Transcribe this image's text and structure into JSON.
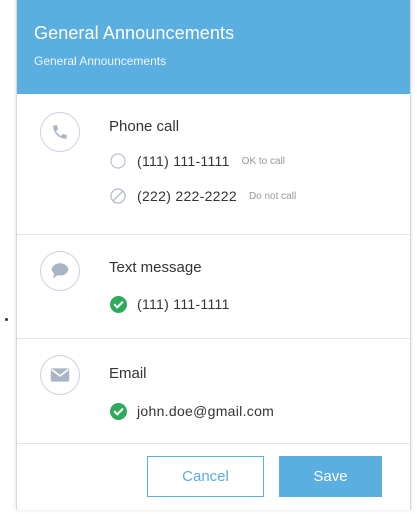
{
  "header": {
    "title": "General Announcements",
    "subtitle": "General Announcements"
  },
  "sections": {
    "phone": {
      "title": "Phone call",
      "icon": "phone-icon",
      "options": [
        {
          "value": "(111) 111-1111",
          "note": "OK to call",
          "status": "unselected-radio"
        },
        {
          "value": "(222) 222-2222",
          "note": "Do not call",
          "status": "blocked"
        }
      ]
    },
    "text": {
      "title": "Text message",
      "icon": "chat-bubble-icon",
      "options": [
        {
          "value": "(111) 111-1111",
          "status": "checked"
        }
      ]
    },
    "email": {
      "title": "Email",
      "icon": "envelope-icon",
      "options": [
        {
          "value": "john.doe@gmail.com",
          "status": "checked"
        }
      ]
    }
  },
  "footer": {
    "cancel_label": "Cancel",
    "save_label": "Save"
  },
  "colors": {
    "accent": "#5aaee0",
    "check": "#2eaa5c",
    "icon_gray": "#a8b5c6"
  }
}
